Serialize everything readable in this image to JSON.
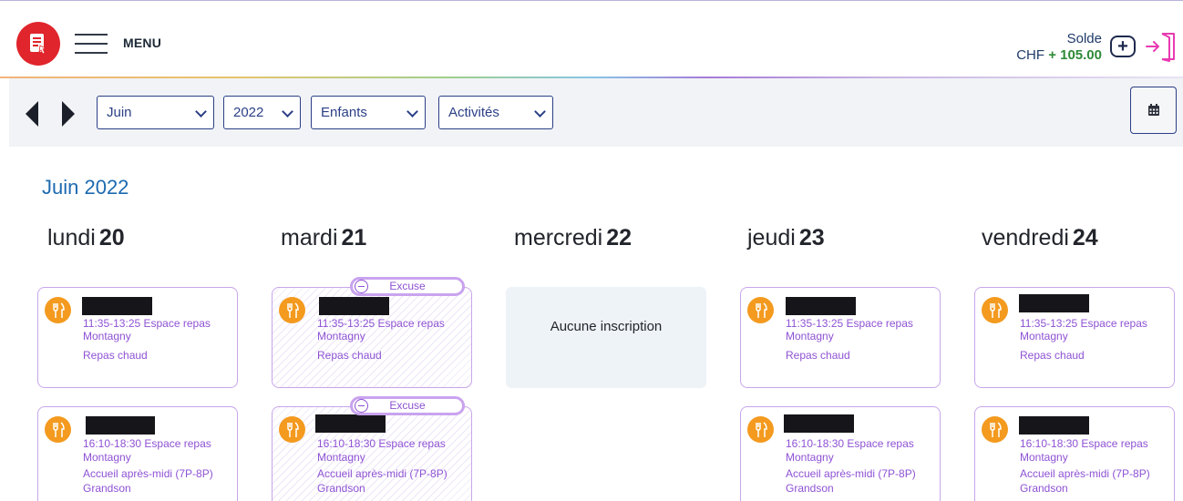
{
  "header": {
    "menu_label": "MENU",
    "balance_label": "Solde",
    "currency": "CHF",
    "amount": "+ 105.00",
    "icons": {
      "logo": "app-logo-icon",
      "menu": "hamburger-icon",
      "add": "plus-icon",
      "logout": "logout-icon"
    }
  },
  "toolbar": {
    "month": "Juin",
    "year": "2022",
    "children": "Enfants",
    "activities": "Activités",
    "icons": {
      "prev": "arrow-left-icon",
      "next": "arrow-right-icon",
      "calendar": "calendar-icon"
    }
  },
  "main": {
    "month_title": "Juin 2022",
    "empty_label": "Aucune inscription",
    "excuse_label": "Excuse",
    "days": [
      {
        "name": "lundi",
        "num": "20"
      },
      {
        "name": "mardi",
        "num": "21"
      },
      {
        "name": "mercredi",
        "num": "22"
      },
      {
        "name": "jeudi",
        "num": "23"
      },
      {
        "name": "vendredi",
        "num": "24"
      }
    ],
    "activities": {
      "lunch": {
        "line1": "11:35-13:25 Espace repas",
        "line2": "Montagny",
        "line3": "Repas chaud",
        "line4": ""
      },
      "afternoon": {
        "line1": "16:10-18:30 Espace repas",
        "line2": "Montagny",
        "line3": "Accueil après-midi (7P-8P)",
        "line4": "Grandson"
      }
    }
  },
  "colors": {
    "logo": "#e0252c",
    "accent": "#2b3f86",
    "month_title": "#1c6ab0",
    "activity_text": "#8e52d4",
    "activity_icon": "#f39a1f",
    "amount": "#2e8a37"
  }
}
